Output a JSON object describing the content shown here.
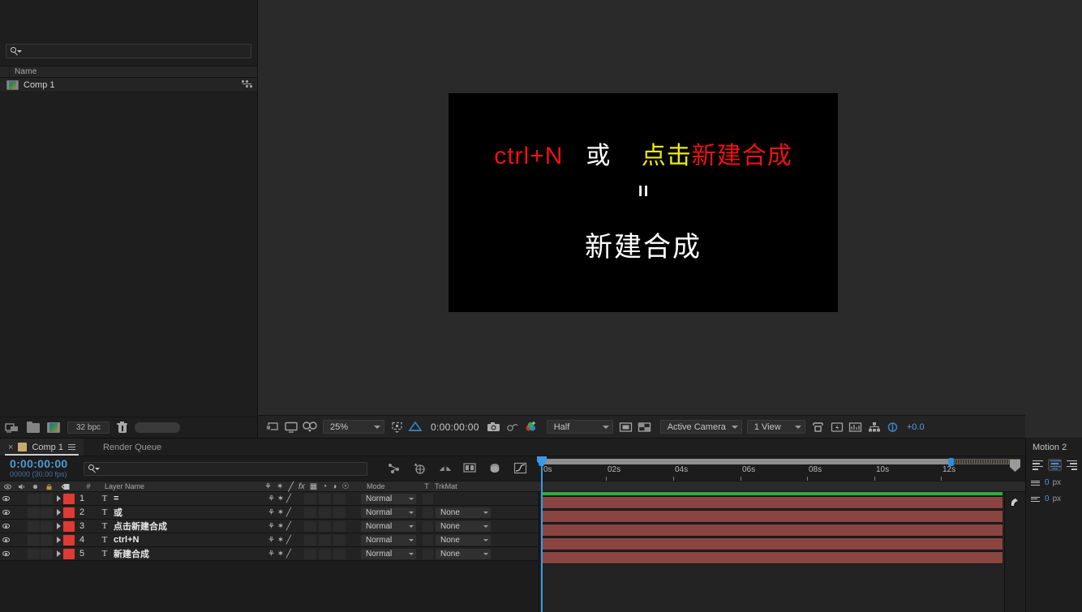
{
  "project_panel": {
    "search_placeholder": "",
    "column_header": "Name",
    "items": [
      {
        "label": "Comp 1",
        "icon": "composition-icon"
      }
    ],
    "footer": {
      "interpret_icon": "interpret-footage-icon",
      "new_folder_icon": "new-folder-icon",
      "new_comp_icon": "new-composition-icon",
      "bit_depth": "32 bpc",
      "delete_icon": "trash-icon"
    }
  },
  "viewer": {
    "canvas": {
      "line1": [
        {
          "text": "ctrl+N",
          "color": "#ef1111"
        },
        {
          "text": "或",
          "color": "#ffffff"
        },
        {
          "text": "点击",
          "color": "#e9ea15"
        },
        {
          "text": "新建合成",
          "color": "#ef1111"
        }
      ],
      "equals": "=",
      "line3": "新建合成",
      "background": "#000000"
    },
    "toolbar": {
      "zoom": "25%",
      "timecode": "0:00:00:00",
      "resolution": "Half",
      "camera": "Active Camera",
      "views": "1 View",
      "exposure": "+0.0",
      "icons": [
        "always-preview-icon",
        "main-viewer-icon",
        "3d-glasses-icon",
        "region-of-interest-icon",
        "transparency-grid-icon",
        "snapshot-icon",
        "show-snapshot-icon",
        "channel-icon",
        "mask-visibility-icon",
        "grid-guides-icon",
        "timeline-ruler-icon",
        "comp-flowchart-icon",
        "reset-exposure-icon"
      ]
    }
  },
  "timeline": {
    "tabs": [
      {
        "label": "Comp 1",
        "active": true
      },
      {
        "label": "Render Queue",
        "active": false
      }
    ],
    "current_time": "0:00:00:00",
    "frame_info": "00000 (30.00 fps)",
    "search_placeholder": "",
    "toolbar_icons": [
      "shy-icon",
      "frame-blending-icon",
      "motion-blur-icon",
      "brainstorm-icon",
      "graph-editor-icon",
      "auto-keyframe-icon"
    ],
    "ruler": {
      "ticks": [
        "0s",
        "02s",
        "04s",
        "06s",
        "08s",
        "10s",
        "12s"
      ],
      "work_area_start": "0s",
      "work_area_end": "12s"
    },
    "columns": {
      "av_features": "",
      "number": "#",
      "layer_name": "Layer Name",
      "mode": "Mode",
      "t": "T",
      "trkmat": "TrkMat"
    },
    "layers": [
      {
        "index": "1",
        "type": "T",
        "name": "=",
        "mode": "Normal",
        "trkmat": "",
        "color": "#e03a34",
        "visible": true
      },
      {
        "index": "2",
        "type": "T",
        "name": "或",
        "mode": "Normal",
        "trkmat": "None",
        "color": "#e03a34",
        "visible": true
      },
      {
        "index": "3",
        "type": "T",
        "name": "点击新建合成",
        "mode": "Normal",
        "trkmat": "None",
        "color": "#e03a34",
        "visible": true
      },
      {
        "index": "4",
        "type": "T",
        "name": "ctrl+N",
        "mode": "Normal",
        "trkmat": "None",
        "color": "#e03a34",
        "visible": true
      },
      {
        "index": "5",
        "type": "T",
        "name": "新建合成",
        "mode": "Normal",
        "trkmat": "None",
        "color": "#e03a34",
        "visible": true
      }
    ]
  },
  "motion_panel": {
    "title": "Motion 2",
    "align_options": [
      "align-left-icon",
      "align-center-icon",
      "align-right-icon"
    ],
    "selected_align": 1,
    "indent_left": {
      "value": "0",
      "unit": "px"
    },
    "indent_right": {
      "value": "0",
      "unit": "px"
    }
  },
  "colors": {
    "accent_blue": "#4b9cd3",
    "layer_red": "#e03a34",
    "layer_bar": "#8a4542",
    "work_green": "#2eae3d",
    "panel_bg": "#1e1e1e"
  }
}
